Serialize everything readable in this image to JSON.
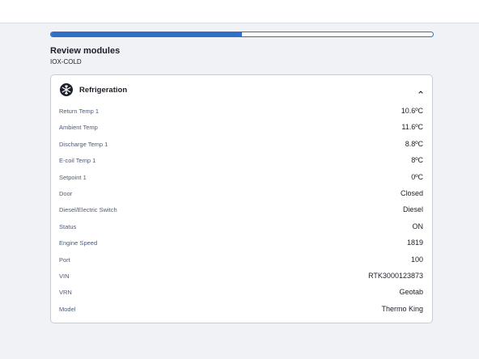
{
  "progress": {
    "fraction": 0.5
  },
  "page": {
    "title": "Review modules",
    "subtitle": "IOX-COLD"
  },
  "card": {
    "icon": "snowflake-icon",
    "title": "Refrigeration",
    "expanded": true,
    "rows": [
      {
        "label": "Return Temp 1",
        "value": "10.6ºC"
      },
      {
        "label": "Ambient Temp",
        "value": "11.6ºC"
      },
      {
        "label": "Discharge Temp 1",
        "value": "8.8ºC"
      },
      {
        "label": "E-coil Temp 1",
        "value": "8ºC"
      },
      {
        "label": "Setpoint 1",
        "value": "0ºC"
      },
      {
        "label": "Door",
        "value": "Closed"
      },
      {
        "label": "Diesel/Electric Switch",
        "value": "Diesel"
      },
      {
        "label": "Status",
        "value": "ON"
      },
      {
        "label": "Engine Speed",
        "value": "1819"
      },
      {
        "label": "Port",
        "value": "100"
      },
      {
        "label": "VIN",
        "value": "RTK3000123873"
      },
      {
        "label": "VRN",
        "value": "Geotab"
      },
      {
        "label": "Model",
        "value": "Thermo King"
      }
    ]
  },
  "colors": {
    "accent": "#2f6fc6",
    "label": "#4d5a78",
    "background": "#f0f2f5"
  }
}
